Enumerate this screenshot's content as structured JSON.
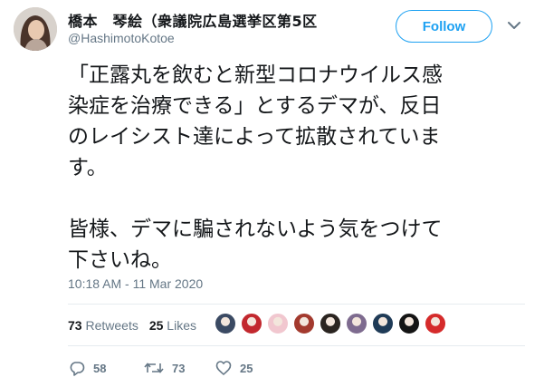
{
  "author": {
    "name": "橋本　琴絵（衆議院広島選挙区第5区",
    "handle": "@HashimotoKotoe",
    "follow_label": "Follow"
  },
  "tweet": {
    "text": "「正露丸を飲むと新型コロナウイルス感\n染症を治療できる」とするデマが、反日\nのレイシスト達によって拡散されていま\nす。\n\n皆様、デマに騙されないよう気をつけて\n下さいね。",
    "timestamp": "10:18 AM - 11 Mar 2020"
  },
  "stats": {
    "retweets_count": "73",
    "retweets_label": "Retweets",
    "likes_count": "25",
    "likes_label": "Likes"
  },
  "liker_avatars": [
    {
      "color": "#3b4a63"
    },
    {
      "color": "#c2282e"
    },
    {
      "color": "#f1c7cf"
    },
    {
      "color": "#a33a2e"
    },
    {
      "color": "#2a2420"
    },
    {
      "color": "#7e6b8f"
    },
    {
      "color": "#1f3b57"
    },
    {
      "color": "#141414"
    },
    {
      "color": "#d52b2b"
    }
  ],
  "actions": {
    "reply_count": "58",
    "retweet_count": "73",
    "like_count": "25"
  },
  "icons": {
    "reply": "reply-icon",
    "retweet": "retweet-icon",
    "like": "heart-icon",
    "caret": "chevron-down-icon"
  },
  "colors": {
    "accent": "#1da1f2",
    "secondary_text": "#657786",
    "divider": "#e6ecf0"
  }
}
